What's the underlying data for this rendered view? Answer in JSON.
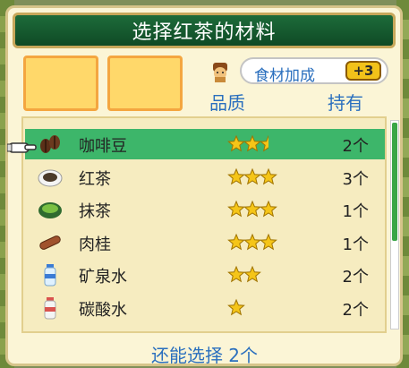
{
  "title": "选择红茶的材料",
  "slots": [
    "",
    ""
  ],
  "bonus": {
    "label": "食材加成",
    "badge": "+3"
  },
  "columns": {
    "quality": "品质",
    "owned": "持有"
  },
  "ingredients": [
    {
      "name": "咖啡豆",
      "stars": 2.5,
      "qty": "2个",
      "icon": "coffee-bean-icon",
      "selected": true
    },
    {
      "name": "红茶",
      "stars": 3,
      "qty": "3个",
      "icon": "black-tea-icon",
      "selected": false
    },
    {
      "name": "抹茶",
      "stars": 3,
      "qty": "1个",
      "icon": "matcha-icon",
      "selected": false
    },
    {
      "name": "肉桂",
      "stars": 3,
      "qty": "1个",
      "icon": "cinnamon-icon",
      "selected": false
    },
    {
      "name": "矿泉水",
      "stars": 2,
      "qty": "2个",
      "icon": "mineral-water-icon",
      "selected": false
    },
    {
      "name": "碳酸水",
      "stars": 1,
      "qty": "2个",
      "icon": "soda-water-icon",
      "selected": false
    }
  ],
  "footer": "还能选择 2个",
  "colors": {
    "accent": "#2a6fbe",
    "selected_row": "#3db66a",
    "title_bg": "#1d6b3a"
  }
}
